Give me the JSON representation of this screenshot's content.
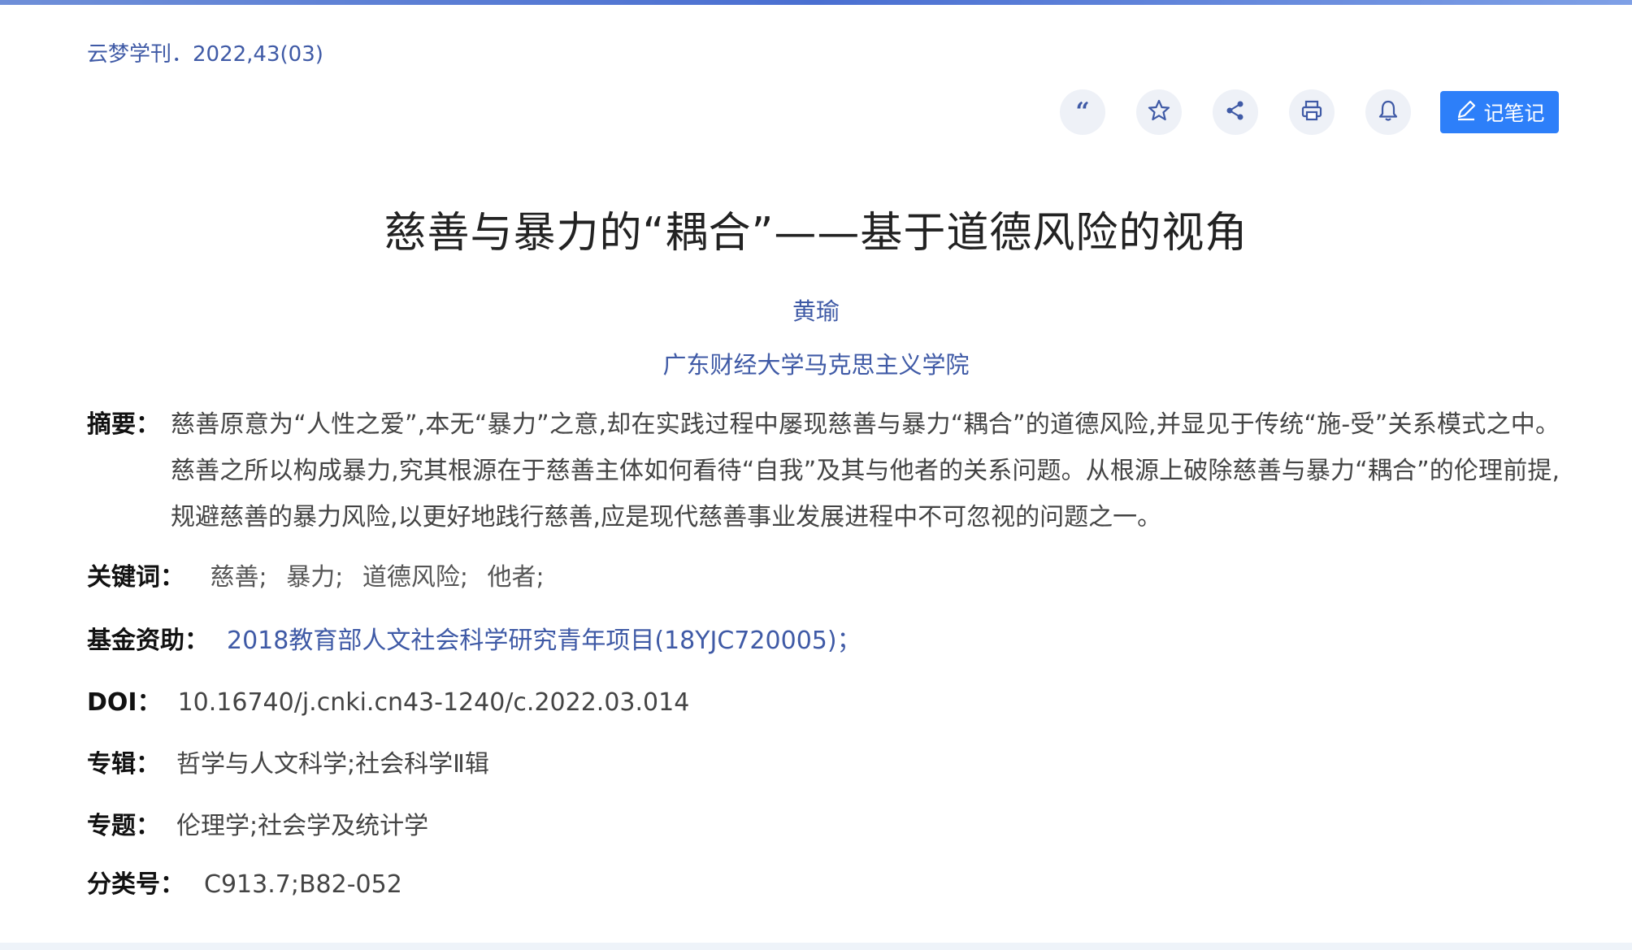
{
  "source": "云梦学刊．2022,43(03)",
  "toolbar": {
    "icons": [
      "quote-icon",
      "star-icon",
      "share-icon",
      "print-icon",
      "bell-icon"
    ],
    "note_label": "记笔记",
    "icon_color": "#3f5aa6",
    "accent": "#2d7ff9"
  },
  "article": {
    "title": "慈善与暴力的“耦合”——基于道德风险的视角",
    "author": "黄瑜",
    "organization": "广东财经大学马克思主义学院",
    "abstract_label": "摘要：",
    "abstract": "慈善原意为“人性之爱”,本无“暴力”之意,却在实践过程中屡现慈善与暴力“耦合”的道德风险,并显见于传统“施-受”关系模式之中。慈善之所以构成暴力,究其根源在于慈善主体如何看待“自我”及其与他者的关系问题。从根源上破除慈善与暴力“耦合”的伦理前提,规避慈善的暴力风险,以更好地践行慈善,应是现代慈善事业发展进程中不可忽视的问题之一。",
    "keywords_label": "关键词：",
    "keywords": [
      "慈善;",
      "暴力;",
      "道德风险;",
      "他者;"
    ],
    "fund_label": "基金资助：",
    "fund": "2018教育部人文社会科学研究青年项目(18YJC720005)；",
    "doi_label": "DOI：",
    "doi": "10.16740/j.cnki.cn43-1240/c.2022.03.014",
    "album_label": "专辑：",
    "album": "哲学与人文科学;社会科学Ⅱ辑",
    "topic_label": "专题：",
    "topic": "伦理学;社会学及统计学",
    "class_label": "分类号：",
    "class_no": "C913.7;B82-052"
  }
}
